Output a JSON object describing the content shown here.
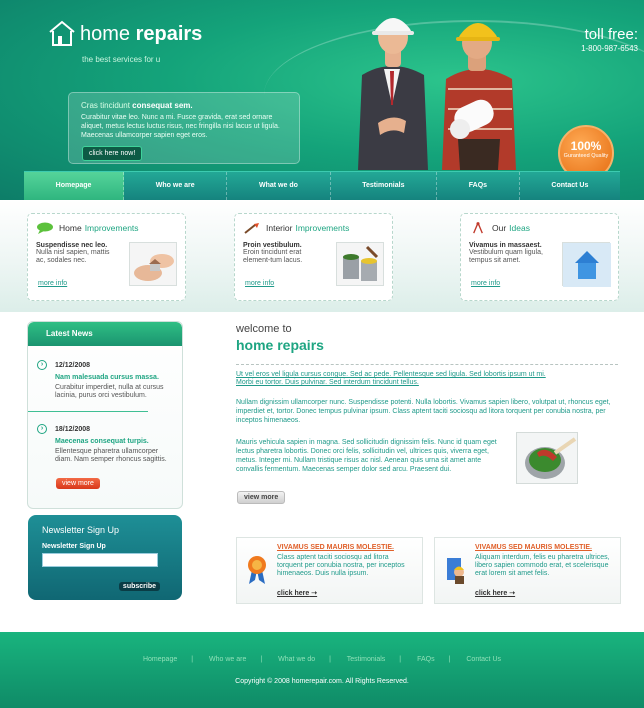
{
  "header": {
    "logo_light": "home",
    "logo_bold": "repairs",
    "tagline": "the best services for u",
    "intro_title_light": "Cras tincidunt",
    "intro_title_bold": "consequat sem.",
    "intro_text": "Curabitur vitae leo. Nunc a mi. Fusce gravida, erat sed ornare aliquet, metus lectus luctus risus, nec fringilla nisi lacus ut ligula. Maecenas ullamcorper sapien eget eros.",
    "intro_button": "click here now!",
    "tollfree_label": "toll free:",
    "tollfree_number": "1-800-987-6543",
    "badge_big": "100%",
    "badge_small": "Guranteed Quality"
  },
  "nav": [
    "Homepage",
    "Who we are",
    "What we do",
    "Testimonials",
    "FAQs",
    "Contact Us"
  ],
  "features": [
    {
      "title_plain": "Home",
      "title_hl": "Improvements",
      "bold": "Suspendisse nec leo.",
      "text": "Nulla nisl sapien, mattis ac, sodales nec.",
      "more": "more info",
      "icon": "speech-bubble-icon"
    },
    {
      "title_plain": "Interior",
      "title_hl": "Improvements",
      "bold": "Proin vestibulum.",
      "text": "Eroin tincidunt erat element-tum lacus.",
      "more": "more info",
      "icon": "paintbrush-icon"
    },
    {
      "title_plain": "Our",
      "title_hl": "Ideas",
      "bold": "Vivamus in massaest.",
      "text": "Vestibulum quam ligula, tempus sit amet.",
      "more": "more info",
      "icon": "compass-icon"
    }
  ],
  "latest_news": {
    "heading": "Latest News",
    "items": [
      {
        "date": "12/12/2008",
        "title": "Nam malesuada cursus massa.",
        "text": "Curabitur imperdiet, nulla at cursus lacinia, purus orci vestibulum."
      },
      {
        "date": "18/12/2008",
        "title": "Maecenas consequat turpis.",
        "text": "Ellentesque pharetra ullamcorper diam. Nam semper rhoncus sagittis."
      }
    ],
    "view_more": "view more"
  },
  "newsletter": {
    "title": "Newsletter Sign Up",
    "label": "Newsletter Sign Up",
    "button": "subscribe"
  },
  "main": {
    "welcome": "welcome to",
    "title": "home repairs",
    "link_text": "Ut vel eros vel ligula cursus congue. Sed ac pede. Pellentesque sed ligula. Sed lobortis ipsum ut mi. Morbi eu tortor. Duis pulvinar. Sed interdum tincidunt tellus.",
    "para1": "Nullam dignissim ullamcorper nunc. Suspendisse potenti. Nulla lobortis. Vivamus sapien libero, volutpat ut, rhoncus eget, imperdiet et, tortor. Donec tempus pulvinar ipsum. Class aptent taciti sociosqu ad litora torquent per conubia nostra, per inceptos himenaeos.",
    "para2": "Mauris vehicula sapien in magna. Sed sollicitudin dignissim felis. Nunc id quam eget lectus pharetra lobortis. Donec orci felis, sollicitudin vel, ultrices quis, viverra eget, metus. Integer mi. Nullam tristique risus ac nisl. Aenean quis urna sit amet ante convallis fermentum. Maecenas semper dolor sed arcu. Praesent dui.",
    "view_more": "view more"
  },
  "promos": [
    {
      "title": "VIVAMUS SED MAURIS MOLESTIE.",
      "text": "Class aptent taciti sociosqu ad litora torquent per conubia nostra, per inceptos himenaeos. Duis nulla ipsum.",
      "link": "click here",
      "icon": "award-ribbon-icon"
    },
    {
      "title": "VIVAMUS SED MAURIS MOLESTIE.",
      "text": "Aliquam interdum, felis eu pharetra ultrices, libero sapien commodo erat, et scelerisque erat lorem sit amet felis.",
      "link": "click here",
      "icon": "worker-icon"
    }
  ],
  "footer": {
    "links": [
      "Homepage",
      "Who we are",
      "What we do",
      "Testimonials",
      "FAQs",
      "Contact Us"
    ],
    "copyright": "Copyright © 2008 homerepair.com. All Rights Reserved."
  }
}
